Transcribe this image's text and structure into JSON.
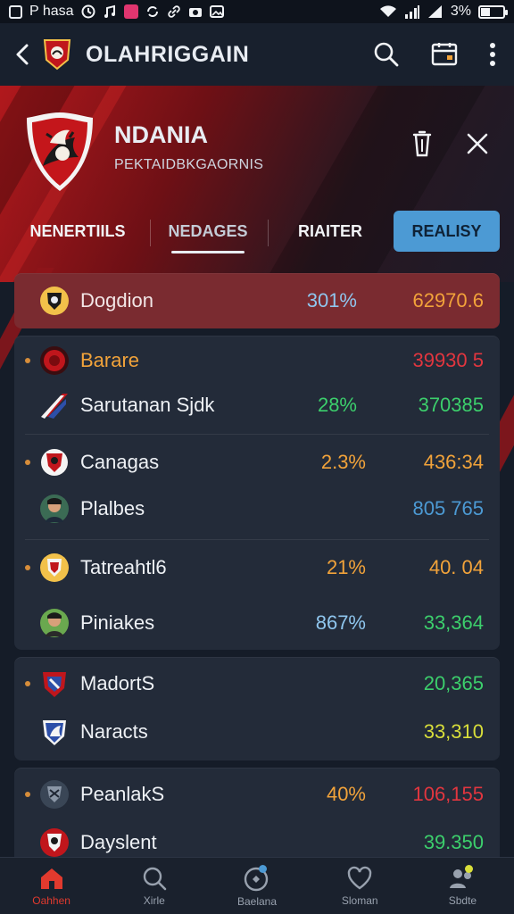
{
  "statusbar": {
    "app_label": "P hasa",
    "battery": "3%"
  },
  "appbar": {
    "title": "OLAHRIGGAIN"
  },
  "team": {
    "name": "NDANIA",
    "subtitle": "PEKTAIDBKGAORNIS"
  },
  "tabs": [
    {
      "label": "NENERTIILS"
    },
    {
      "label": "NEDAGES"
    },
    {
      "label": "RIAITER"
    },
    {
      "label": "REALISY"
    }
  ],
  "rows": [
    {
      "name": "Dogdion",
      "pct": "301%",
      "value": "62970.6",
      "name_color": "#f2e6e6",
      "pct_color": "#8fc6ee",
      "value_color": "#f2a33a"
    },
    {
      "name": "Barare",
      "pct": "",
      "value": "39930 5",
      "name_color": "#f2a33a",
      "pct_color": "#8fc6ee",
      "value_color": "#e2363f"
    },
    {
      "name": "Sarutanan Sjdk",
      "pct": "28%",
      "value": "370385",
      "name_color": "#eef1f5",
      "pct_color": "#3ccf6c",
      "value_color": "#3ccf6c"
    },
    {
      "name": "Canagas",
      "pct": "2.3%",
      "value": "436:34",
      "name_color": "#eef1f5",
      "pct_color": "#f2a33a",
      "value_color": "#f2a33a"
    },
    {
      "name": "Plalbes",
      "pct": "",
      "value": "805 765",
      "name_color": "#eef1f5",
      "pct_color": "#8fc6ee",
      "value_color": "#4c9ad4"
    },
    {
      "name": "Tatreahtl6",
      "pct": "21%",
      "value": "40. 04",
      "name_color": "#eef1f5",
      "pct_color": "#f2a33a",
      "value_color": "#f2a33a"
    },
    {
      "name": "Piniakes",
      "pct": "867%",
      "value": "33,364",
      "name_color": "#eef1f5",
      "pct_color": "#8fc6ee",
      "value_color": "#3ccf6c"
    },
    {
      "name": "MadortS",
      "pct": "",
      "value": "20,365",
      "name_color": "#eef1f5",
      "pct_color": "#8fc6ee",
      "value_color": "#3ccf6c"
    },
    {
      "name": "Naracts",
      "pct": "",
      "value": "33,310",
      "name_color": "#eef1f5",
      "pct_color": "#8fc6ee",
      "value_color": "#d8de3a"
    },
    {
      "name": "PeanlakS",
      "pct": "40%",
      "value": "106,155",
      "name_color": "#eef1f5",
      "pct_color": "#f2a33a",
      "value_color": "#e2363f"
    },
    {
      "name": "Dayslent",
      "pct": "",
      "value": "39.350",
      "name_color": "#eef1f5",
      "pct_color": "#8fc6ee",
      "value_color": "#3ccf6c"
    }
  ],
  "nav": [
    {
      "label": "Oahhen",
      "icon": "home-icon"
    },
    {
      "label": "Xirle",
      "icon": "search-icon"
    },
    {
      "label": "Baelana",
      "icon": "compass-icon"
    },
    {
      "label": "Sloman",
      "icon": "heart-icon"
    },
    {
      "label": "Sbdte",
      "icon": "people-icon"
    }
  ],
  "colors": {
    "accent": "#4c9ad4",
    "brand_red": "#c0161c",
    "nav_active": "#e13a2e"
  }
}
